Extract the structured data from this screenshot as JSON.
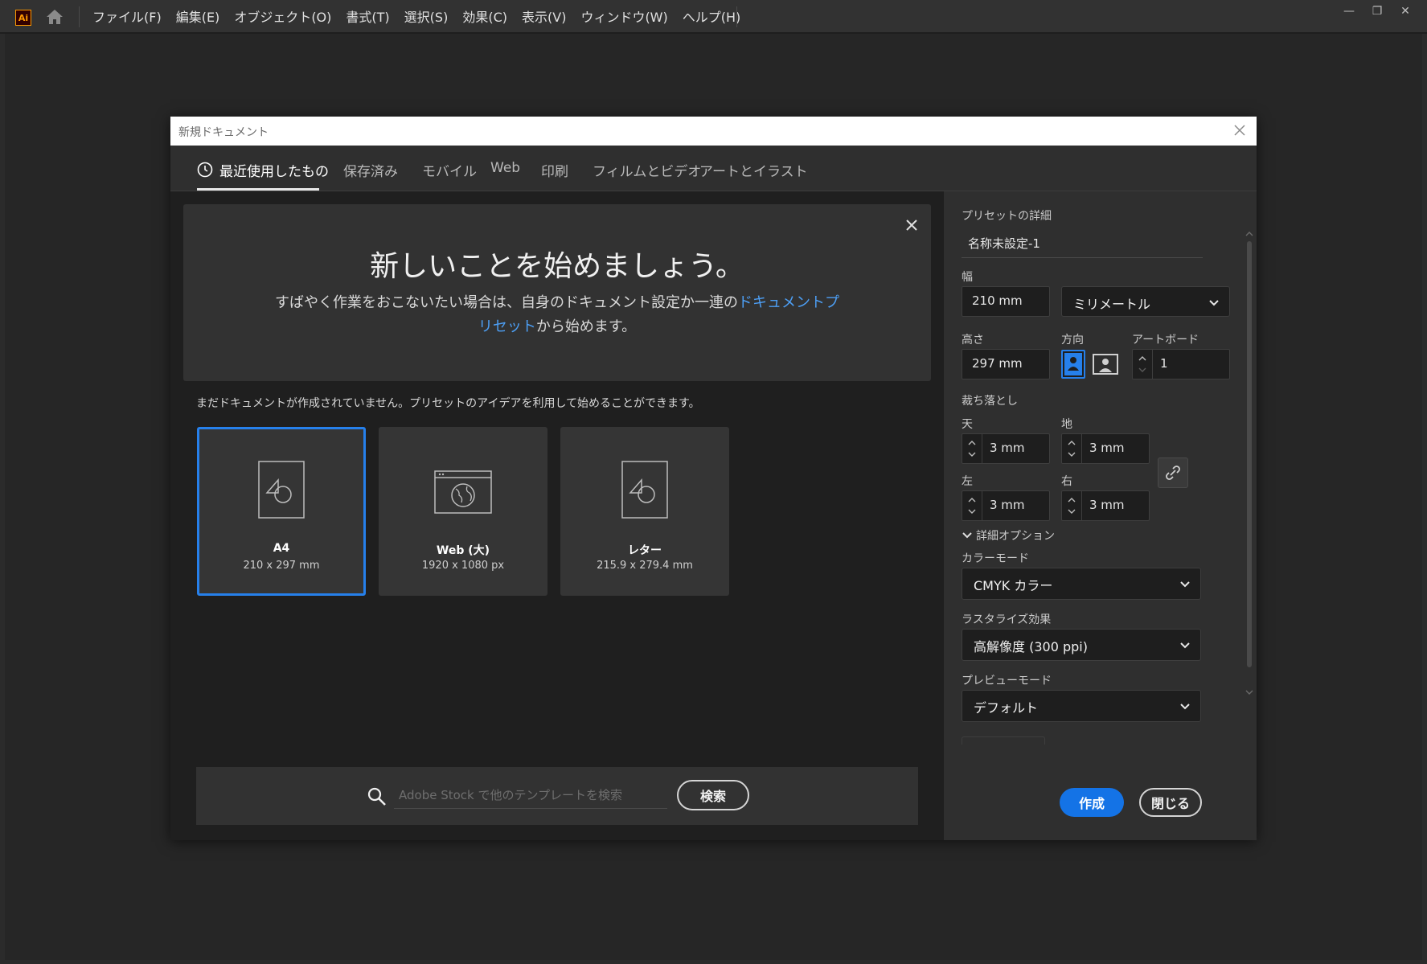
{
  "app": {
    "logo": "Ai",
    "home_icon": "home-icon"
  },
  "menu": [
    "ファイル(F)",
    "編集(E)",
    "オブジェクト(O)",
    "書式(T)",
    "選択(S)",
    "効果(C)",
    "表示(V)",
    "ウィンドウ(W)",
    "ヘルプ(H)"
  ],
  "window_controls": {
    "minimize": "—",
    "restore": "❐",
    "close": "✕"
  },
  "dialog": {
    "title": "新規ドキュメント",
    "tabs": [
      "最近使用したもの",
      "保存済み",
      "モバイル",
      "Web",
      "印刷",
      "フィルムとビデオ",
      "アートとイラスト"
    ],
    "banner": {
      "title": "新しいことを始めましょう。",
      "desc_before": "すばやく作業をおこないたい場合は、自身のドキュメント設定か一連の",
      "desc_link": "ドキュメントプリセット",
      "desc_after": "から始めます。"
    },
    "hint": "まだドキュメントが作成されていません。プリセットのアイデアを利用して始めることができます。",
    "presets": [
      {
        "name": "A4",
        "size": "210 x 297 mm",
        "icon": "document-shapes-icon"
      },
      {
        "name": "Web (大)",
        "size": "1920 x 1080 px",
        "icon": "web-globe-icon"
      },
      {
        "name": "レター",
        "size": "215.9 x 279.4 mm",
        "icon": "document-shapes-icon"
      }
    ],
    "search": {
      "placeholder": "Adobe Stock で他のテンプレートを検索",
      "button": "検索"
    },
    "details": {
      "section_title": "プリセットの詳細",
      "name_value": "名称未設定-1",
      "width_label": "幅",
      "width_value": "210 mm",
      "unit_value": "ミリメートル",
      "height_label": "高さ",
      "height_value": "297 mm",
      "orientation_label": "方向",
      "artboard_label": "アートボード",
      "artboard_value": "1",
      "bleed_label": "裁ち落とし",
      "bleed_top_label": "天",
      "bleed_top_value": "3 mm",
      "bleed_bottom_label": "地",
      "bleed_bottom_value": "3 mm",
      "bleed_left_label": "左",
      "bleed_left_value": "3 mm",
      "bleed_right_label": "右",
      "bleed_right_value": "3 mm",
      "advanced_label": "詳細オプション",
      "color_mode_label": "カラーモード",
      "color_mode_value": "CMYK カラー",
      "raster_label": "ラスタライズ効果",
      "raster_value": "高解像度 (300 ppi)",
      "preview_label": "プレビューモード",
      "preview_value": "デフォルト"
    },
    "buttons": {
      "create": "作成",
      "close": "閉じる"
    }
  }
}
